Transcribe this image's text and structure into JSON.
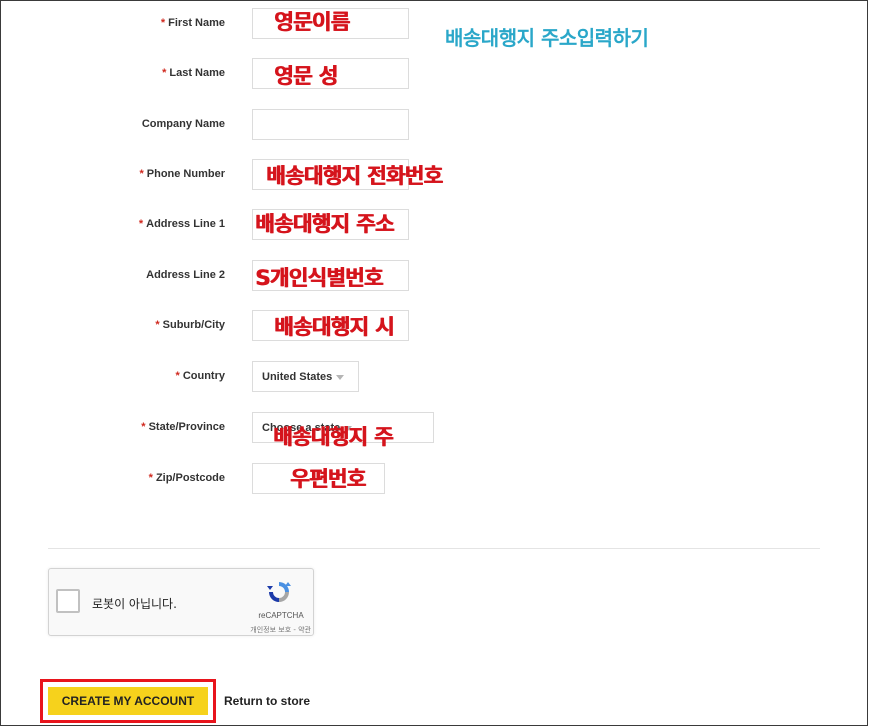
{
  "form": {
    "fields": [
      {
        "label": "First Name",
        "required": true,
        "value": "",
        "annotation": "영문이름"
      },
      {
        "label": "Last Name",
        "required": true,
        "value": "",
        "annotation": "영문 성"
      },
      {
        "label": "Company Name",
        "required": false,
        "value": "",
        "annotation": ""
      },
      {
        "label": "Phone Number",
        "required": true,
        "value": "",
        "annotation": "배송대행지 전화번호"
      },
      {
        "label": "Address Line 1",
        "required": true,
        "value": "",
        "annotation": "배송대행지 주소"
      },
      {
        "label": "Address Line 2",
        "required": false,
        "value": "",
        "annotation": "S개인식별번호"
      },
      {
        "label": "Suburb/City",
        "required": true,
        "value": "",
        "annotation": "배송대행지 시"
      },
      {
        "label": "Country",
        "required": true,
        "value": "United States",
        "annotation": ""
      },
      {
        "label": "State/Province",
        "required": true,
        "value": "Choose a state",
        "annotation": "배송대행지 주"
      },
      {
        "label": "Zip/Postcode",
        "required": true,
        "value": "",
        "annotation": "우편번호"
      }
    ],
    "required_mark": "*"
  },
  "section_annotation": "배송대행지 주소입력하기",
  "captcha": {
    "label": "로봇이 아닙니다.",
    "brand": "reCAPTCHA",
    "links": "개인정보 보호 - 약관"
  },
  "actions": {
    "create_label": "CREATE MY ACCOUNT",
    "return_label": "Return to store"
  },
  "colors": {
    "required": "#d0281e",
    "annotation": "#d5141c",
    "annotation_blue": "#2aa7c9",
    "button": "#f6d21c",
    "highlight": "#e8141c"
  }
}
